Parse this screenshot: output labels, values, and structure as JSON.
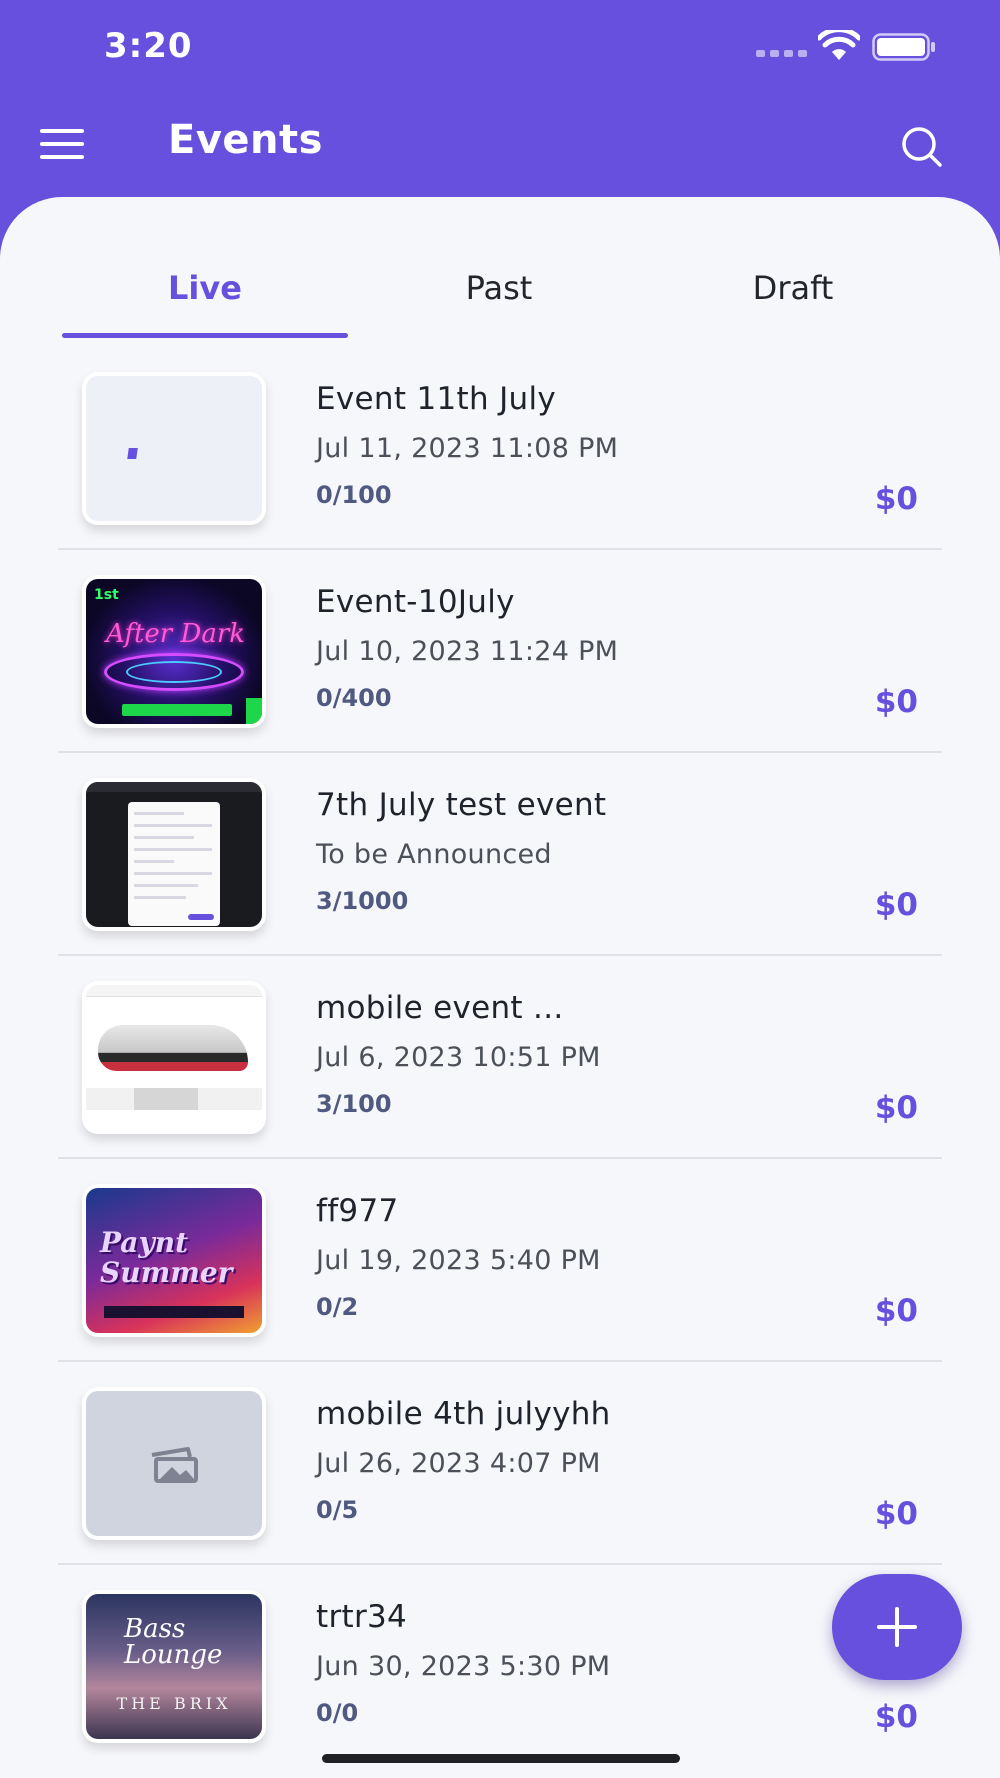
{
  "status_bar": {
    "time": "3:20"
  },
  "header": {
    "title": "Events",
    "menu_icon": "hamburger-menu-icon",
    "search_icon": "search-icon"
  },
  "tabs": [
    {
      "label": "Live",
      "active": true
    },
    {
      "label": "Past",
      "active": false
    },
    {
      "label": "Draft",
      "active": false
    }
  ],
  "events": [
    {
      "name": "Event 11th July",
      "date": "Jul 11, 2023 11:08 PM",
      "count": "0/100",
      "price": "$0",
      "thumbnail": "blank"
    },
    {
      "name": "Event-10July",
      "date": "Jul 10, 2023 11:24 PM",
      "count": "0/400",
      "price": "$0",
      "thumbnail": "neon-party-poster"
    },
    {
      "name": "7th July test event",
      "date": " To be Announced",
      "count": "3/1000",
      "price": "$0",
      "thumbnail": "app-screenshot"
    },
    {
      "name": "mobile event ...",
      "date": "Jul 6, 2023 10:51 PM",
      "count": "3/100",
      "price": "$0",
      "thumbnail": "shoe-product-screenshot"
    },
    {
      "name": "ff977",
      "date": "Jul 19, 2023 5:40 PM",
      "count": "0/2",
      "price": "$0",
      "thumbnail": "museum-of-paynt-poster"
    },
    {
      "name": "mobile 4th julyyhh",
      "date": "Jul 26, 2023 4:07 PM",
      "count": "0/5",
      "price": "$0",
      "thumbnail": "image-placeholder-icon"
    },
    {
      "name": "trtr34",
      "date": "Jun 30, 2023 5:30 PM",
      "count": "0/0",
      "price": "$0",
      "thumbnail": "bass-lounge-poster"
    }
  ],
  "fab": {
    "icon": "plus-icon"
  },
  "colors": {
    "primary": "#6650dd",
    "background": "#f6f7fb",
    "text": "#1f232b"
  }
}
